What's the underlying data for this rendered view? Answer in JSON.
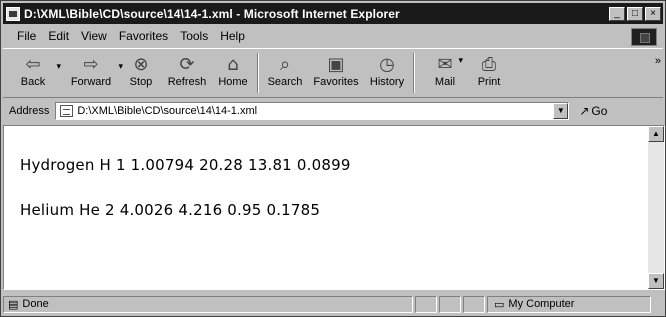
{
  "window": {
    "title": "D:\\XML\\Bible\\CD\\source\\14\\14-1.xml - Microsoft Internet Explorer",
    "controls": [
      "_",
      "□",
      "×"
    ]
  },
  "menu": [
    "File",
    "Edit",
    "View",
    "Favorites",
    "Tools",
    "Help"
  ],
  "toolbar": {
    "back": "Back",
    "forward": "Forward",
    "stop": "Stop",
    "refresh": "Refresh",
    "home": "Home",
    "search": "Search",
    "favorites": "Favorites",
    "history": "History",
    "mail": "Mail",
    "print": "Print",
    "more": "»"
  },
  "address": {
    "label": "Address",
    "value": "D:\\XML\\Bible\\CD\\source\\14\\14-1.xml",
    "go": "Go"
  },
  "content": {
    "lines": [
      "Hydrogen H 1 1.00794 20.28 13.81 0.0899",
      "Helium He 2 4.0026 4.216 0.95 0.1785"
    ]
  },
  "status": {
    "text": "Done",
    "zone": "My Computer"
  },
  "icons": {
    "back": "back-arrow-icon",
    "forward": "forward-arrow-icon",
    "stop": "stop-icon",
    "refresh": "refresh-icon",
    "home": "home-icon",
    "search": "search-icon",
    "favorites": "favorites-icon",
    "history": "history-icon",
    "mail": "mail-icon",
    "print": "print-icon"
  }
}
